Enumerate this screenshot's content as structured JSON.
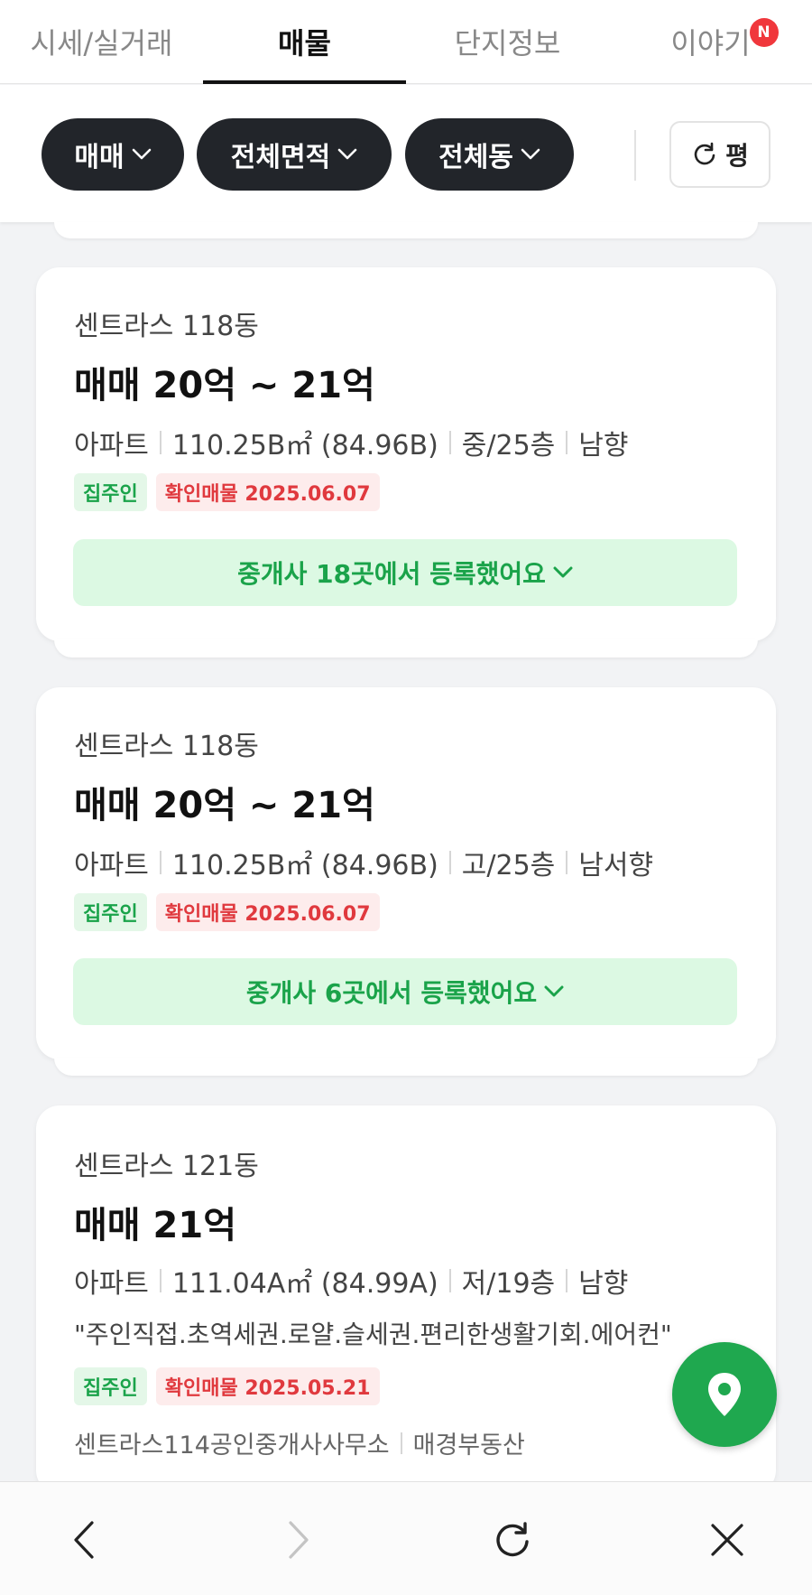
{
  "tabs": [
    {
      "label": "시세/실거래"
    },
    {
      "label": "매물"
    },
    {
      "label": "단지정보"
    },
    {
      "label": "이야기",
      "badge": "N"
    }
  ],
  "filters": {
    "chips": [
      "매매",
      "전체면적",
      "전체동"
    ],
    "unit_button": "평"
  },
  "listings": [
    {
      "building": "센트라스 118동",
      "price": "매매 20억 ~ 21억",
      "type": "아파트",
      "area": "110.25B㎡ (84.96B)",
      "floor": "중/25층",
      "direction": "남향",
      "owner_tag": "집주인",
      "confirm_tag": "확인매물 2025.06.07",
      "agent_bar": "중개사 18곳에서 등록했어요"
    },
    {
      "building": "센트라스 118동",
      "price": "매매 20억 ~ 21억",
      "type": "아파트",
      "area": "110.25B㎡ (84.96B)",
      "floor": "고/25층",
      "direction": "남서향",
      "owner_tag": "집주인",
      "confirm_tag": "확인매물 2025.06.07",
      "agent_bar": "중개사 6곳에서 등록했어요"
    },
    {
      "building": "센트라스 121동",
      "price": "매매 21억",
      "type": "아파트",
      "area": "111.04A㎡ (84.99A)",
      "floor": "저/19층",
      "direction": "남향",
      "description": "\"주인직접.초역세권.로얄.슬세권.편리한생활기회.에어컨\"",
      "owner_tag": "집주인",
      "confirm_tag": "확인매물 2025.05.21",
      "agency_1": "센트라스114공인중개사사무소",
      "agency_2": "매경부동산"
    }
  ],
  "colors": {
    "accent_green": "#1fa84f",
    "chip_dark": "#22252a",
    "badge_red": "#f0373c"
  },
  "icons": {
    "fab": "map-pin-icon",
    "back": "back-arrow-icon",
    "forward": "forward-arrow-icon",
    "reload": "reload-icon",
    "close": "close-icon"
  }
}
